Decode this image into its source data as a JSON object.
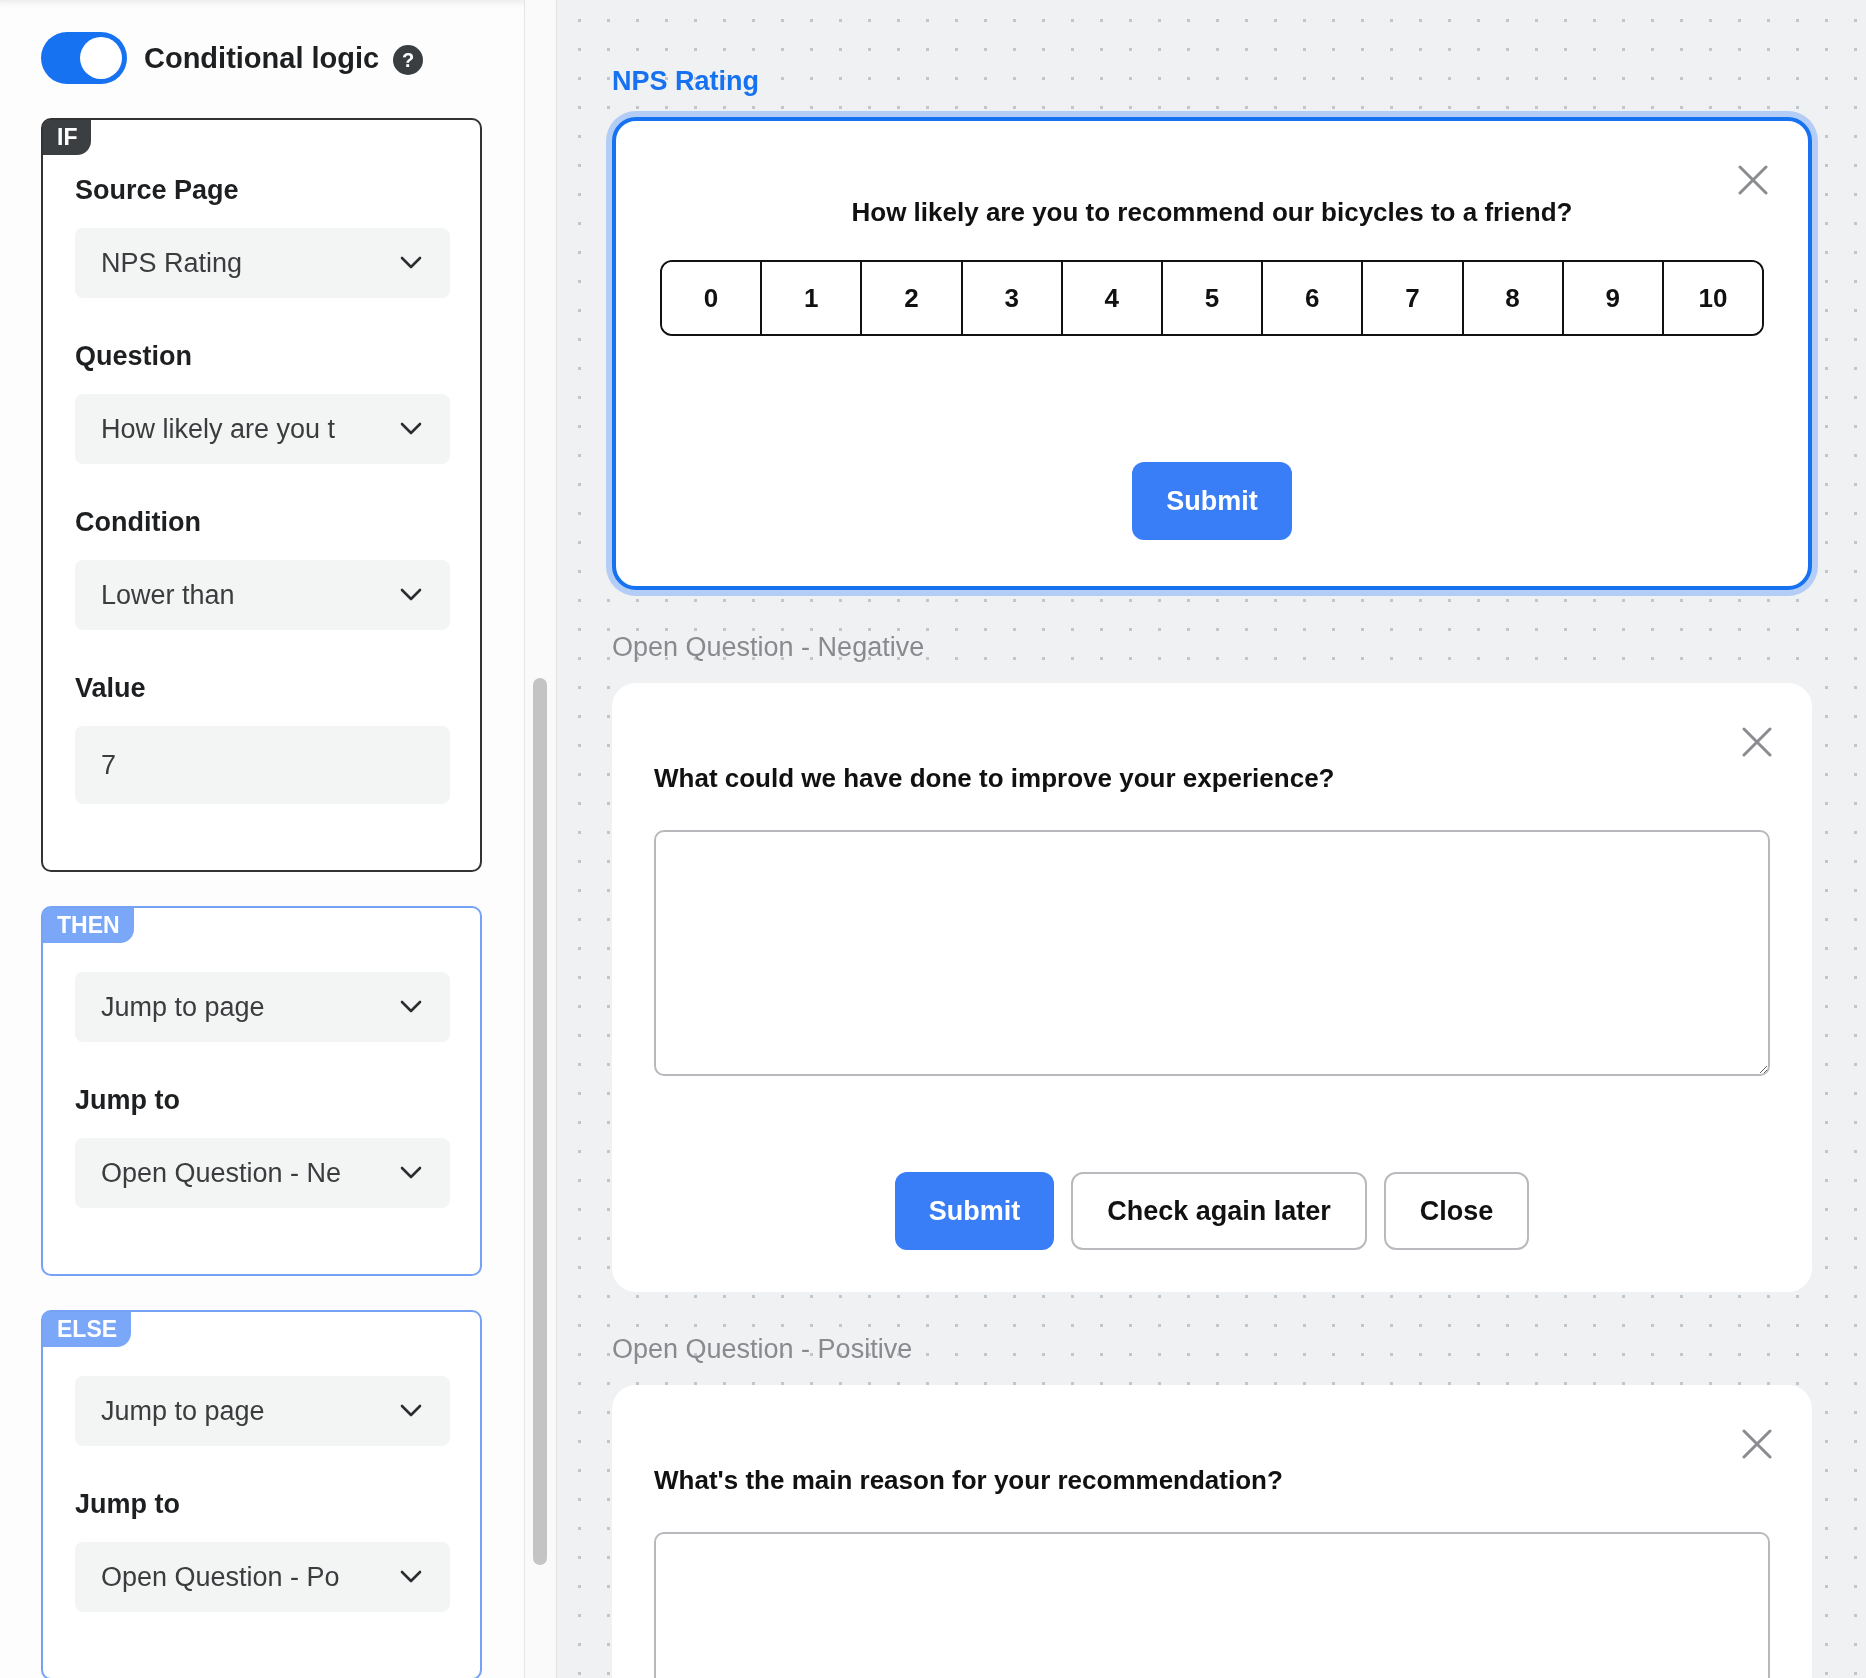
{
  "sidebar": {
    "toggle": {
      "label": "Conditional logic",
      "on": true,
      "help": "?"
    },
    "blocks": [
      {
        "kind": "if",
        "tag": "IF",
        "fields": [
          {
            "kind": "select",
            "label": "Source Page",
            "value": "NPS Rating"
          },
          {
            "kind": "select",
            "label": "Question",
            "value": "How likely are you t"
          },
          {
            "kind": "select",
            "label": "Condition",
            "value": "Lower than"
          },
          {
            "kind": "input",
            "label": "Value",
            "value": "7"
          }
        ]
      },
      {
        "kind": "then",
        "tag": "THEN",
        "fields": [
          {
            "kind": "select",
            "value": "Jump to page"
          },
          {
            "kind": "select",
            "label": "Jump to",
            "value": "Open Question - Ne"
          }
        ]
      },
      {
        "kind": "else",
        "tag": "ELSE",
        "fields": [
          {
            "kind": "select",
            "value": "Jump to page"
          },
          {
            "kind": "select",
            "label": "Jump to",
            "value": "Open Question - Po"
          }
        ]
      }
    ]
  },
  "canvas": {
    "pages": [
      {
        "kind": "nps",
        "title": "NPS Rating",
        "selected": true,
        "question": "How likely are you to recommend our bicycles to a friend?",
        "scale": [
          "0",
          "1",
          "2",
          "3",
          "4",
          "5",
          "6",
          "7",
          "8",
          "9",
          "10"
        ],
        "buttons": [
          {
            "kind": "primary",
            "label": "Submit"
          }
        ]
      },
      {
        "kind": "open",
        "title": "Open Question - Negative",
        "selected": false,
        "question": "What could we have done to improve your experience?",
        "buttons": [
          {
            "kind": "primary",
            "label": "Submit"
          },
          {
            "kind": "secondary",
            "label": "Check again later"
          },
          {
            "kind": "secondary",
            "label": "Close"
          }
        ]
      },
      {
        "kind": "open",
        "title": "Open Question - Positive",
        "selected": false,
        "question": "What's the main reason for your recommendation?"
      }
    ]
  }
}
